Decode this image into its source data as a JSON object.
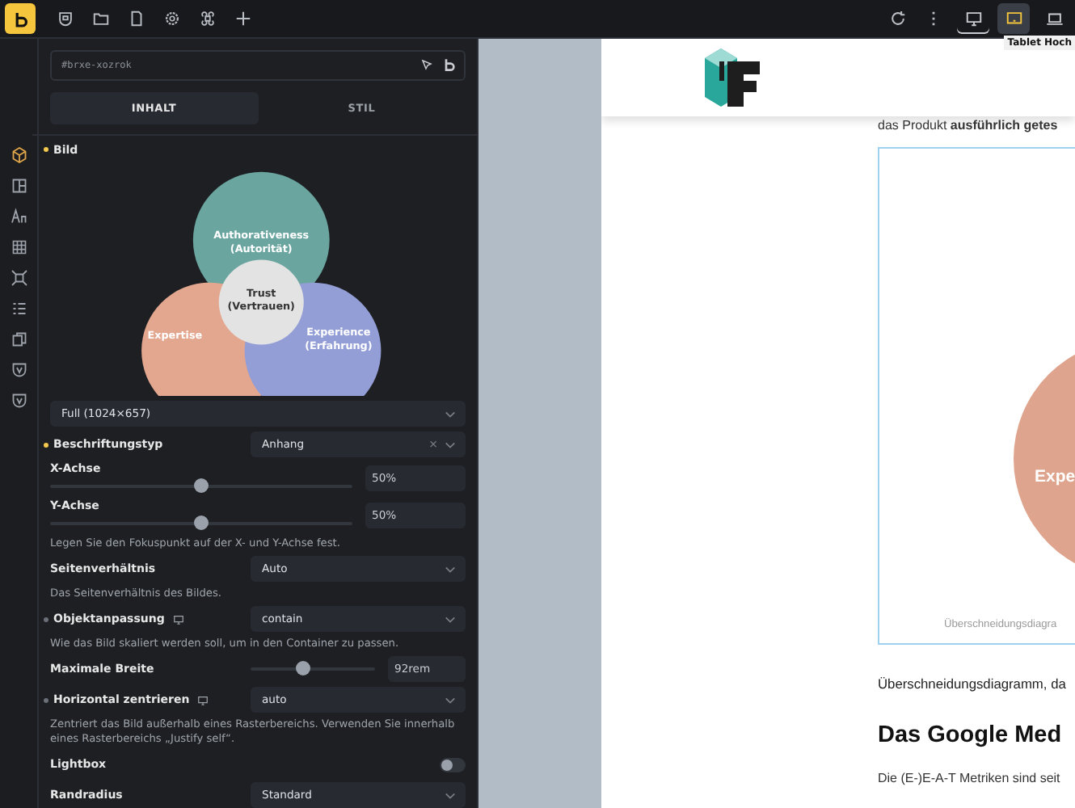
{
  "toolbar": {
    "devices": [
      {
        "selected": false,
        "base": true
      },
      {
        "selected": true,
        "base": false
      },
      {
        "selected": false,
        "base": false
      }
    ],
    "tooltip": "Tablet Hoch"
  },
  "rail": [
    {
      "selected": true
    },
    {
      "selected": false
    },
    {
      "selected": false
    },
    {
      "selected": false
    },
    {
      "selected": false
    },
    {
      "selected": false
    },
    {
      "selected": false
    },
    {
      "selected": false
    },
    {
      "selected": false
    }
  ],
  "panel": {
    "selector": "#brxe-xozrok",
    "tabs": [
      {
        "label": "INHALT",
        "selected": true
      },
      {
        "label": "STIL",
        "selected": false
      }
    ],
    "section": {
      "label": "Bild",
      "color": "#f2c94c"
    },
    "image": {
      "labels": [
        {
          "kind": "top",
          "lines": [
            "Authorativeness",
            "(Autorität)"
          ]
        },
        {
          "kind": "left",
          "lines": [
            "Expertise"
          ]
        },
        {
          "kind": "right",
          "lines": [
            "Experience",
            "(Erfahrung)"
          ]
        },
        {
          "kind": "center",
          "lines": [
            "Trust",
            "(Vertrauen)"
          ]
        }
      ]
    },
    "controls": [
      {
        "kind": "wide_select",
        "value": "Full (1024×657)"
      },
      {
        "kind": "select",
        "label": "Beschriftungstyp",
        "color": "#f2c94c",
        "value": "Anhang",
        "clear": "×"
      },
      {
        "kind": "slider",
        "label": "X-Achse",
        "level": 0.5,
        "value": "50%"
      },
      {
        "kind": "slider",
        "label": "Y-Achse",
        "level": 0.5,
        "value": "50%"
      },
      {
        "kind": "help",
        "text": "Legen Sie den Fokuspunkt auf der X- und Y-Achse fest."
      },
      {
        "kind": "select",
        "label": "Seitenverhältnis",
        "value": "Auto"
      },
      {
        "kind": "help",
        "text": "Das Seitenverhältnis des Bildes."
      },
      {
        "kind": "select",
        "label": "Objektanpassung",
        "color": "#6b7078",
        "responsive": true,
        "value": "contain"
      },
      {
        "kind": "help",
        "text": "Wie das Bild skaliert werden soll, um in den Container zu passen."
      },
      {
        "kind": "inline_slider",
        "label": "Maximale Breite",
        "level": 0.42,
        "value": "92rem"
      },
      {
        "kind": "select",
        "label": "Horizontal zentrieren",
        "color": "#6b7078",
        "responsive": true,
        "value": "auto"
      },
      {
        "kind": "help",
        "text": "Zentriert das Bild außerhalb eines Rasterbereichs. Verwenden Sie innerhalb eines Rasterbereichs „Justify self“."
      },
      {
        "kind": "toggle",
        "label": "Lightbox",
        "on": false
      },
      {
        "kind": "select",
        "label": "Randradius",
        "value": "Standard"
      }
    ]
  },
  "page": {
    "intro": "das Produkt **ausführlich getes**",
    "figure": {
      "circle_label": "Expe",
      "caption": "Überschneidungsdiagra"
    },
    "paragraph": "Überschneidungsdiagramm, da",
    "heading": "Das Google Med",
    "body": "Die (E-)E-A-T Metriken sind seit"
  }
}
